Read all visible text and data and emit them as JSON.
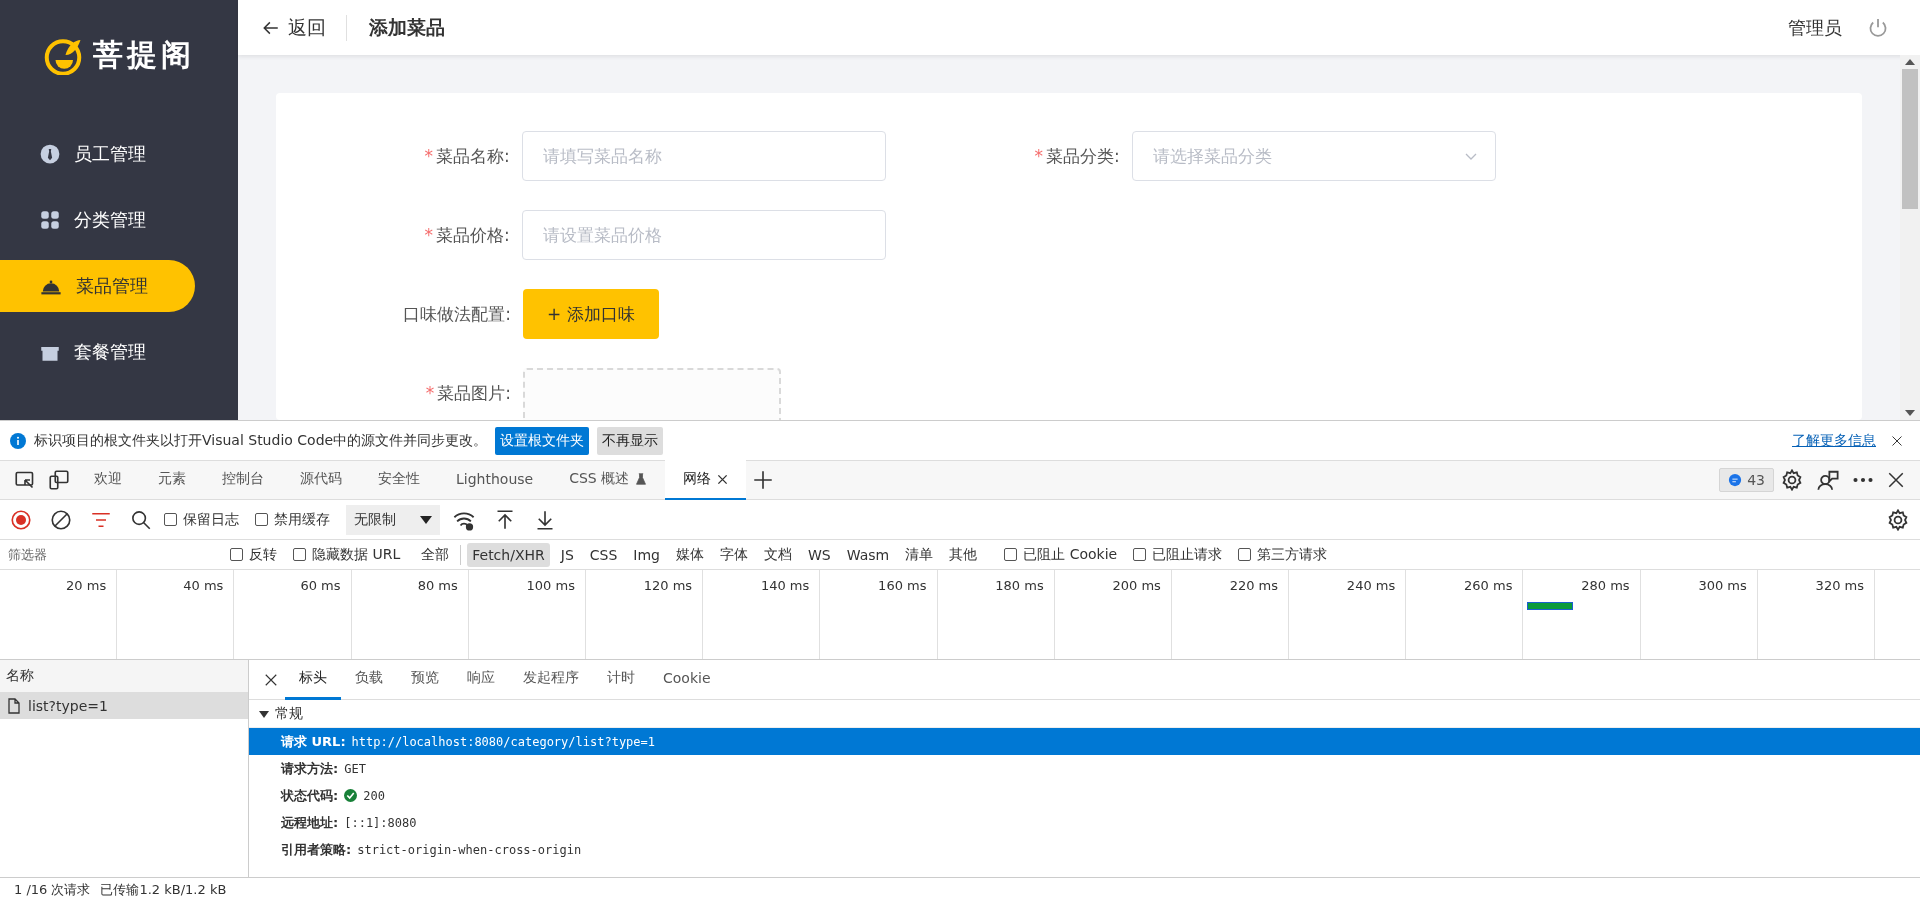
{
  "sidebar": {
    "logo": "菩提阁",
    "items": [
      {
        "label": "员工管理",
        "selected": false,
        "kind": "staff"
      },
      {
        "label": "分类管理",
        "selected": false,
        "kind": "category"
      },
      {
        "label": "菜品管理",
        "selected": true,
        "kind": "dish"
      },
      {
        "label": "套餐管理",
        "selected": false,
        "kind": "combo"
      }
    ]
  },
  "header": {
    "back": "返回",
    "title": "添加菜品",
    "user": "管理员"
  },
  "form": {
    "required_mark": "*",
    "rows": [
      [
        {
          "kind": "input",
          "label": "菜品名称:",
          "required": true,
          "placeholder": "请填写菜品名称"
        },
        {
          "kind": "select",
          "label": "菜品分类:",
          "required": true,
          "placeholder": "请选择菜品分类"
        }
      ],
      [
        {
          "kind": "input",
          "label": "菜品价格:",
          "required": true,
          "placeholder": "请设置菜品价格"
        }
      ],
      [
        {
          "kind": "button",
          "label": "口味做法配置:",
          "required": false,
          "button": "+ 添加口味"
        }
      ],
      [
        {
          "kind": "upload",
          "label": "菜品图片:",
          "required": true
        }
      ]
    ]
  },
  "notice": {
    "text": "标识项目的根文件夹以打开Visual Studio Code中的源文件并同步更改。",
    "primary": "设置根文件夹",
    "secondary": "不再显示",
    "link": "了解更多信息"
  },
  "devtools": {
    "tabs": [
      {
        "label": "欢迎",
        "selected": false
      },
      {
        "label": "元素",
        "selected": false
      },
      {
        "label": "控制台",
        "selected": false
      },
      {
        "label": "源代码",
        "selected": false
      },
      {
        "label": "安全性",
        "selected": false
      },
      {
        "label": "Lighthouse",
        "selected": false
      },
      {
        "label": "CSS 概述",
        "selected": false,
        "experimental": true
      },
      {
        "label": "网络",
        "selected": true,
        "closable": true
      }
    ],
    "issues": "43"
  },
  "toolbar": {
    "checkboxes": [
      {
        "label": "保留日志",
        "checked": false
      },
      {
        "label": "禁用缓存",
        "checked": false
      }
    ],
    "throttling": "无限制"
  },
  "filter": {
    "placeholder": "筛选器",
    "options": [
      {
        "label": "反转",
        "checked": false
      },
      {
        "label": "隐藏数据 URL",
        "checked": false
      }
    ],
    "types": [
      {
        "label": "全部",
        "selected": false
      },
      {
        "label": "Fetch/XHR",
        "selected": true
      },
      {
        "label": "JS",
        "selected": false
      },
      {
        "label": "CSS",
        "selected": false
      },
      {
        "label": "Img",
        "selected": false
      },
      {
        "label": "媒体",
        "selected": false
      },
      {
        "label": "字体",
        "selected": false
      },
      {
        "label": "文档",
        "selected": false
      },
      {
        "label": "WS",
        "selected": false
      },
      {
        "label": "Wasm",
        "selected": false
      },
      {
        "label": "清单",
        "selected": false
      },
      {
        "label": "其他",
        "selected": false
      }
    ],
    "blocked": [
      {
        "label": "已阻止 Cookie",
        "checked": false
      },
      {
        "label": "已阻止请求",
        "checked": false
      },
      {
        "label": "第三方请求",
        "checked": false
      }
    ]
  },
  "timeline": {
    "ticks": [
      "20 ms",
      "40 ms",
      "60 ms",
      "80 ms",
      "100 ms",
      "120 ms",
      "140 ms",
      "160 ms",
      "180 ms",
      "200 ms",
      "220 ms",
      "240 ms",
      "260 ms",
      "280 ms",
      "300 ms",
      "320 ms"
    ]
  },
  "requests": {
    "header": "名称",
    "items": [
      {
        "name": "list?type=1",
        "selected": true
      }
    ]
  },
  "details": {
    "tabs": [
      {
        "label": "标头",
        "selected": true
      },
      {
        "label": "负载",
        "selected": false
      },
      {
        "label": "预览",
        "selected": false
      },
      {
        "label": "响应",
        "selected": false
      },
      {
        "label": "发起程序",
        "selected": false
      },
      {
        "label": "计时",
        "selected": false
      },
      {
        "label": "Cookie",
        "selected": false
      }
    ],
    "section": {
      "title": "常规",
      "expanded": true,
      "rows": [
        {
          "key": "请求 URL:",
          "value": "http://localhost:8080/category/list?type=1",
          "selected": true,
          "kind": "text"
        },
        {
          "key": "请求方法:",
          "value": "GET",
          "selected": false,
          "kind": "text"
        },
        {
          "key": "状态代码:",
          "value": "200",
          "selected": false,
          "kind": "status"
        },
        {
          "key": "远程地址:",
          "value": "[::1]:8080",
          "selected": false,
          "kind": "text"
        },
        {
          "key": "引用者策略:",
          "value": "strict-origin-when-cross-origin",
          "selected": false,
          "kind": "text"
        }
      ]
    }
  },
  "status_bar": {
    "requests": "1 /16 次请求",
    "transferred": "已传输1.2 kB/1.2 kB"
  }
}
